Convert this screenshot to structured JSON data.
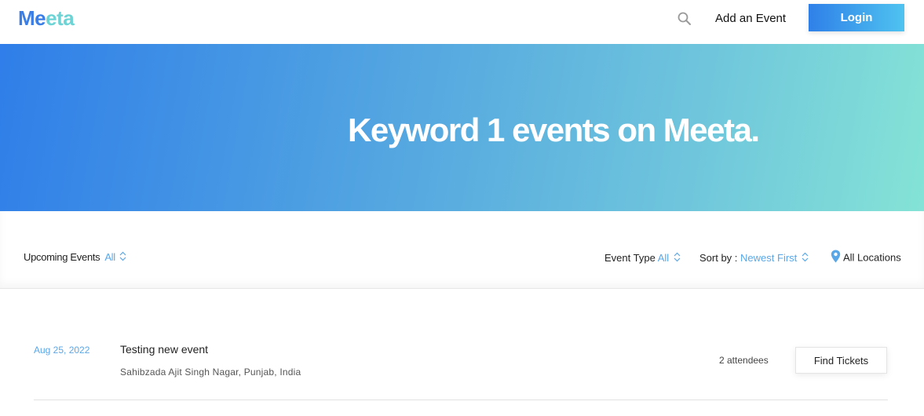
{
  "header": {
    "logo_part1": "Me",
    "logo_part2": "eta",
    "search_icon": "search-icon",
    "add_event_label": "Add an Event",
    "login_label": "Login"
  },
  "hero": {
    "title": "Keyword 1 events on Meeta."
  },
  "filters": {
    "upcoming_label": "Upcoming Events",
    "upcoming_value": "All",
    "event_type_label": "Event Type",
    "event_type_value": "All",
    "sort_label": "Sort by :",
    "sort_value": "Newest First",
    "location_label": "All Locations",
    "location_icon": "map-pin-icon"
  },
  "events": [
    {
      "date": "Aug 25, 2022",
      "title": "Testing new event",
      "location": "Sahibzada Ajit Singh Nagar, Punjab, India",
      "attendees": "2 attendees",
      "button": "Find Tickets"
    }
  ],
  "colors": {
    "accent": "#5aa7e8",
    "brand_blue": "#3a7ee6",
    "brand_teal": "#6ed3d4"
  }
}
